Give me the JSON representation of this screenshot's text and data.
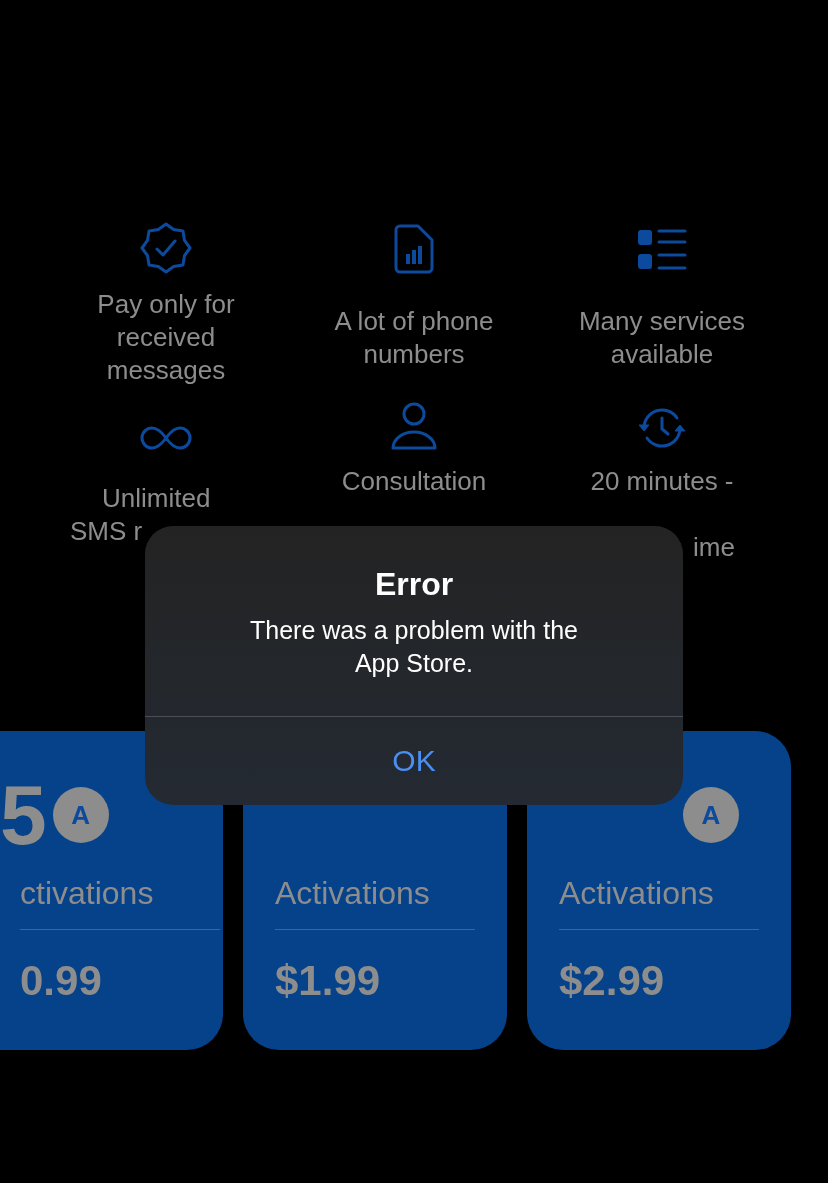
{
  "features": [
    {
      "lines": [
        "Pay only for",
        "received",
        "messages"
      ]
    },
    {
      "lines": [
        "A lot of phone",
        "numbers"
      ]
    },
    {
      "lines": [
        "Many services",
        "available"
      ]
    },
    {
      "lines": [
        "Unlimited",
        "SMS r"
      ]
    },
    {
      "lines": [
        "Consultation"
      ]
    },
    {
      "lines": [
        "20 minutes -",
        "ime"
      ]
    }
  ],
  "plans": [
    {
      "count": "5",
      "badge": "A",
      "label": "ctivations",
      "price": "0.99"
    },
    {
      "label": "Activations",
      "price": "$1.99"
    },
    {
      "badge": "A",
      "label": "Activations",
      "price": "$2.99"
    }
  ],
  "alert": {
    "title": "Error",
    "message": "There was a problem with the App Store.",
    "button": "OK"
  }
}
